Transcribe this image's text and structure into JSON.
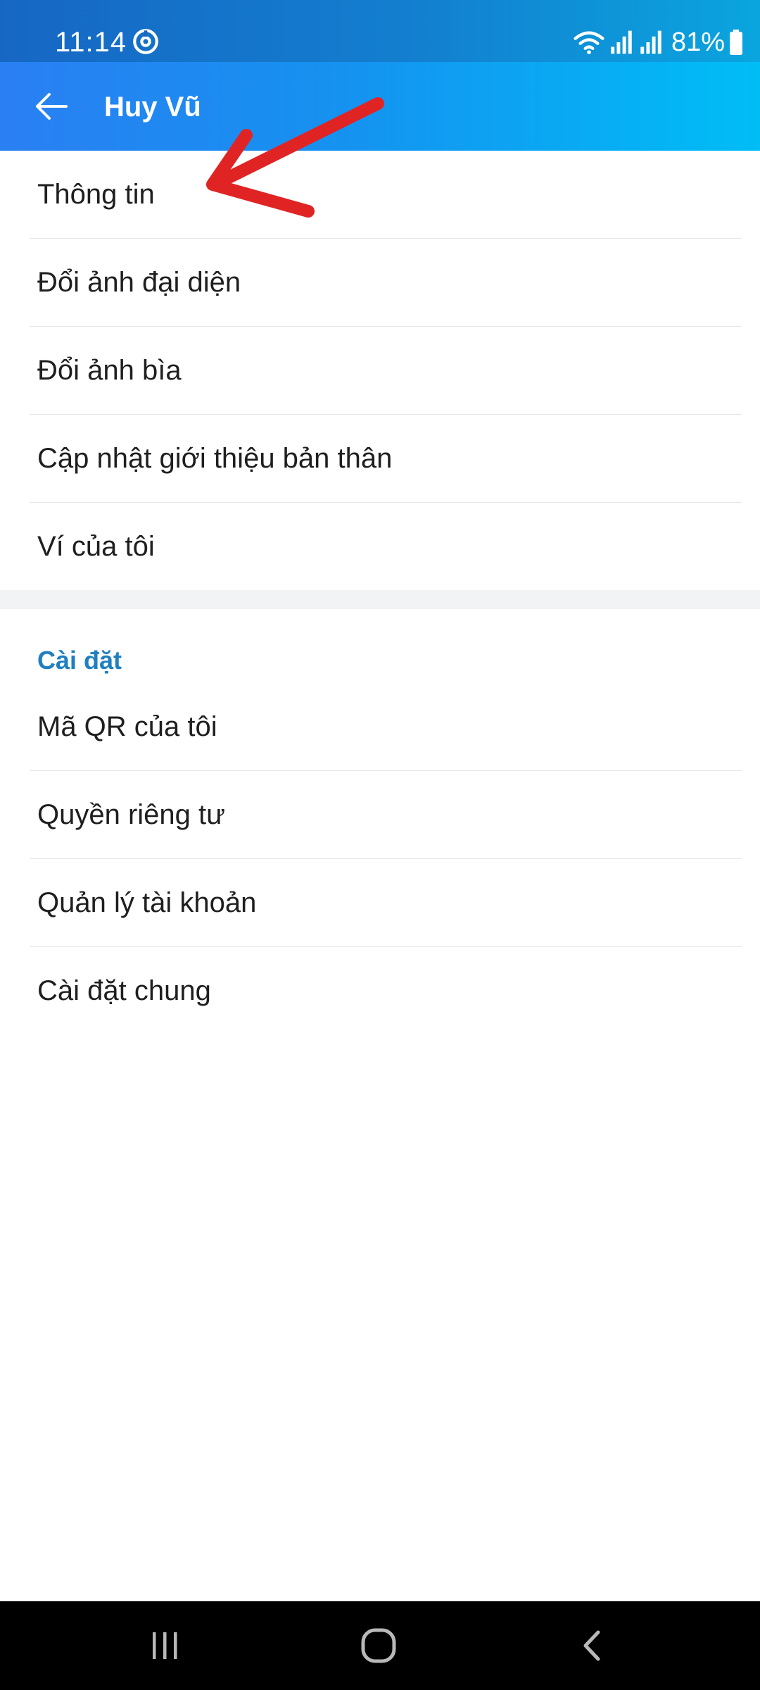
{
  "status_bar": {
    "time": "11:14",
    "battery": "81%",
    "icons": [
      "sync-icon",
      "wifi-icon",
      "signal-icon",
      "signal-icon",
      "battery-icon"
    ]
  },
  "app_bar": {
    "back_icon": "arrow-left-icon",
    "title": "Huy Vũ",
    "gradient": [
      "#2a7ff2",
      "#00bdf6"
    ]
  },
  "profile_menu": {
    "items": [
      {
        "label": "Thông tin"
      },
      {
        "label": "Đổi ảnh đại diện"
      },
      {
        "label": "Đổi ảnh bìa"
      },
      {
        "label": "Cập nhật giới thiệu bản thân"
      },
      {
        "label": "Ví của tôi"
      }
    ]
  },
  "settings_section": {
    "header": "Cài đặt",
    "header_color": "#1f7fc0",
    "items": [
      {
        "label": "Mã QR của tôi"
      },
      {
        "label": "Quyền riêng tư"
      },
      {
        "label": "Quản lý tài khoản"
      },
      {
        "label": "Cài đặt chung"
      }
    ]
  },
  "annotation": {
    "type": "red-arrow",
    "color": "#e02424",
    "points_to": "Thông tin"
  },
  "nav_bar": {
    "buttons": [
      "recent-apps-icon",
      "home-icon",
      "back-icon"
    ]
  }
}
